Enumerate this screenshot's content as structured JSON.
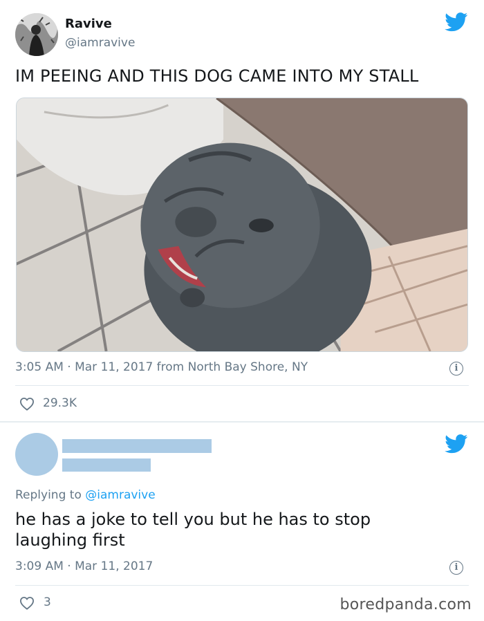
{
  "colors": {
    "twitter_blue": "#1da1f2",
    "muted": "#657786",
    "redaction": "#abcbe5"
  },
  "tweet1": {
    "user": {
      "name": "Ravive",
      "handle": "@iamravive"
    },
    "text": "IM PEEING AND THIS DOG CAME INTO MY STALL",
    "timestamp": "3:05 AM · Mar 11, 2017 from North Bay Shore, NY",
    "likes": "29.3K",
    "icons": {
      "logo": "twitter-bird-icon",
      "info": "info-icon",
      "like": "heart-icon"
    }
  },
  "tweet2": {
    "reply_prefix": "Replying to ",
    "reply_mention": "@iamravive",
    "text": "he has a joke to tell you but he has to stop laughing first",
    "timestamp": "3:09 AM · Mar 11, 2017",
    "likes": "3",
    "icons": {
      "logo": "twitter-bird-icon",
      "info": "info-icon",
      "like": "heart-icon"
    }
  },
  "watermark": "boredpanda.com"
}
